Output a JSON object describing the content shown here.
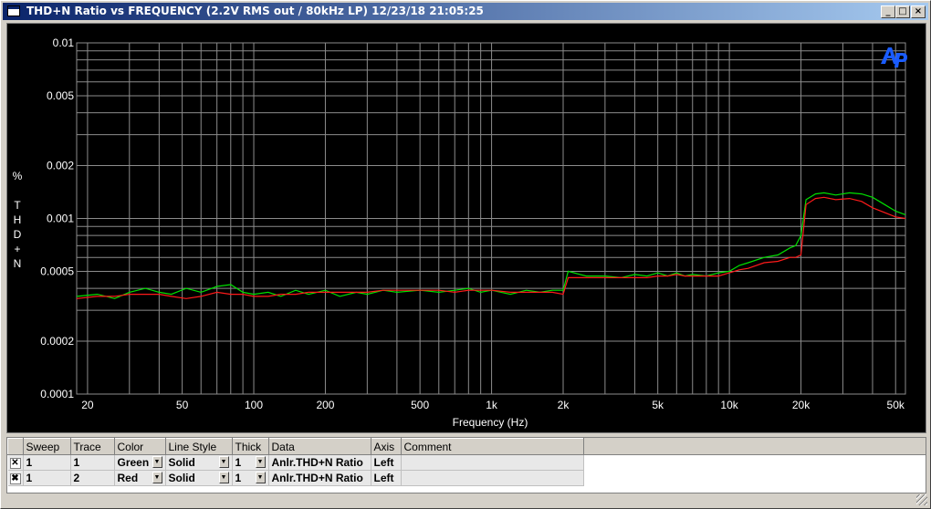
{
  "window": {
    "title": "THD+N Ratio vs FREQUENCY (2.2V RMS out / 80kHz LP)  12/23/18 21:05:25",
    "minimize_glyph": "_",
    "maximize_glyph": "□",
    "close_glyph": "×"
  },
  "chart_data": {
    "type": "line",
    "title": "",
    "xlabel": "Frequency (Hz)",
    "ylabel_unit": "%",
    "ylabel": "THD+N",
    "x_scale": "log",
    "y_scale": "log",
    "xlim": [
      18,
      55000
    ],
    "ylim": [
      0.0001,
      0.01
    ],
    "grid": true,
    "x_ticks": [
      {
        "value": 20,
        "label": "20"
      },
      {
        "value": 50,
        "label": "50"
      },
      {
        "value": 100,
        "label": "100"
      },
      {
        "value": 200,
        "label": "200"
      },
      {
        "value": 500,
        "label": "500"
      },
      {
        "value": 1000,
        "label": "1k"
      },
      {
        "value": 2000,
        "label": "2k"
      },
      {
        "value": 5000,
        "label": "5k"
      },
      {
        "value": 10000,
        "label": "10k"
      },
      {
        "value": 20000,
        "label": "20k"
      },
      {
        "value": 50000,
        "label": "50k"
      }
    ],
    "y_ticks": [
      {
        "value": 0.01,
        "label": "0.01"
      },
      {
        "value": 0.005,
        "label": "0.005"
      },
      {
        "value": 0.002,
        "label": "0.002"
      },
      {
        "value": 0.001,
        "label": "0.001"
      },
      {
        "value": 0.0005,
        "label": "0.0005"
      },
      {
        "value": 0.0002,
        "label": "0.0002"
      },
      {
        "value": 0.0001,
        "label": "0.0001"
      }
    ],
    "background_color": "#000000",
    "grid_color": "#8c8c8c",
    "series": [
      {
        "color": "#00e000",
        "x": [
          18,
          22,
          26,
          30,
          35,
          40,
          45,
          52,
          60,
          70,
          80,
          90,
          100,
          115,
          130,
          150,
          170,
          200,
          230,
          270,
          300,
          350,
          400,
          500,
          600,
          700,
          800,
          900,
          1000,
          1200,
          1400,
          1600,
          1800,
          2000,
          2100,
          2500,
          3000,
          3500,
          4000,
          4500,
          5000,
          5500,
          6000,
          6500,
          7000,
          8000,
          9000,
          10000,
          11000,
          12000,
          14000,
          16000,
          18000,
          19000,
          20000,
          21000,
          23000,
          25000,
          28000,
          32000,
          36000,
          40000,
          45000,
          50000,
          55000
        ],
        "y": [
          0.00036,
          0.00037,
          0.00035,
          0.00038,
          0.0004,
          0.00038,
          0.00037,
          0.0004,
          0.00038,
          0.00041,
          0.00042,
          0.00038,
          0.00037,
          0.00038,
          0.00036,
          0.00039,
          0.00037,
          0.00039,
          0.00036,
          0.00038,
          0.00037,
          0.00039,
          0.00038,
          0.00039,
          0.00038,
          0.00039,
          0.0004,
          0.00038,
          0.00039,
          0.00037,
          0.00039,
          0.00038,
          0.00039,
          0.00039,
          0.0005,
          0.00047,
          0.00047,
          0.00046,
          0.00048,
          0.00047,
          0.00049,
          0.00047,
          0.00049,
          0.00047,
          0.00048,
          0.00047,
          0.00049,
          0.0005,
          0.00054,
          0.00056,
          0.0006,
          0.00062,
          0.00068,
          0.0007,
          0.0008,
          0.00128,
          0.00138,
          0.0014,
          0.00136,
          0.0014,
          0.00138,
          0.00132,
          0.0012,
          0.0011,
          0.00105
        ]
      },
      {
        "color": "#ff1a1a",
        "x": [
          18,
          22,
          26,
          30,
          35,
          40,
          45,
          52,
          60,
          70,
          80,
          90,
          100,
          115,
          130,
          150,
          170,
          200,
          230,
          270,
          300,
          350,
          400,
          500,
          600,
          700,
          800,
          900,
          1000,
          1200,
          1400,
          1600,
          1800,
          2000,
          2100,
          2500,
          3000,
          3500,
          4000,
          4500,
          5000,
          5500,
          6000,
          6500,
          7000,
          8000,
          9000,
          10000,
          11000,
          12000,
          14000,
          16000,
          18000,
          19000,
          20000,
          21000,
          23000,
          25000,
          28000,
          32000,
          36000,
          40000,
          45000,
          50000,
          55000
        ],
        "y": [
          0.00035,
          0.00036,
          0.00036,
          0.00037,
          0.00037,
          0.00037,
          0.00036,
          0.00035,
          0.00036,
          0.00038,
          0.00037,
          0.00037,
          0.00036,
          0.00036,
          0.00037,
          0.00037,
          0.00038,
          0.00038,
          0.00038,
          0.00038,
          0.00038,
          0.00039,
          0.00039,
          0.00039,
          0.00039,
          0.00038,
          0.00039,
          0.00039,
          0.00039,
          0.00038,
          0.00038,
          0.00038,
          0.00038,
          0.00037,
          0.00046,
          0.00046,
          0.00046,
          0.00046,
          0.00046,
          0.00046,
          0.00047,
          0.00047,
          0.00048,
          0.00047,
          0.00047,
          0.00047,
          0.00047,
          0.00049,
          0.00051,
          0.00052,
          0.00056,
          0.00057,
          0.0006,
          0.0006,
          0.00062,
          0.0012,
          0.0013,
          0.00132,
          0.00128,
          0.0013,
          0.00125,
          0.00115,
          0.00108,
          0.00102,
          0.001
        ]
      }
    ]
  },
  "trace_table": {
    "columns": [
      "Sweep",
      "Trace",
      "Color",
      "Line Style",
      "Thick",
      "Data",
      "Axis",
      "Comment"
    ],
    "rows": [
      {
        "checked": false,
        "sweep": "1",
        "trace": "1",
        "color": "Green",
        "line_style": "Solid",
        "thick": "1",
        "data": "Anlr.THD+N Ratio",
        "axis": "Left",
        "comment": ""
      },
      {
        "checked": true,
        "sweep": "1",
        "trace": "2",
        "color": "Red",
        "line_style": "Solid",
        "thick": "1",
        "data": "Anlr.THD+N Ratio",
        "axis": "Left",
        "comment": ""
      }
    ],
    "check_on": "✖",
    "check_off": "✕",
    "dropdown_glyph": "▼"
  }
}
